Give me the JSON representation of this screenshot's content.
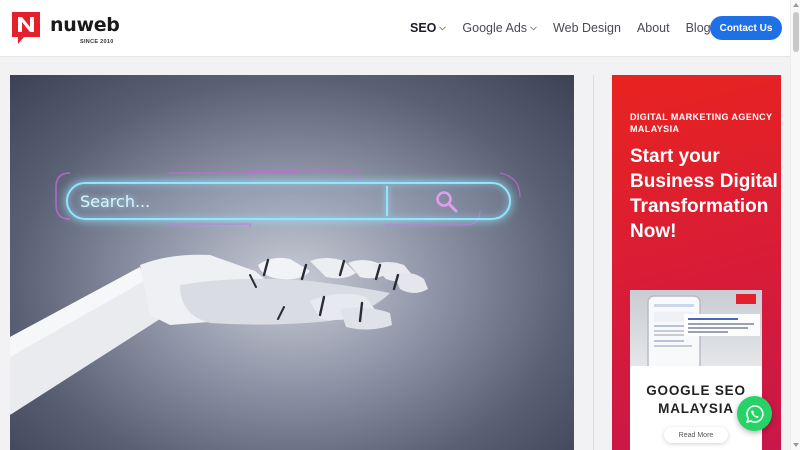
{
  "brand": {
    "name": "nuweb",
    "since": "SINCE 2010",
    "logo_color": "#e3212d",
    "logo_letter": "N"
  },
  "nav": {
    "items": [
      {
        "label": "SEO",
        "dropdown": true,
        "active": true
      },
      {
        "label": "Google Ads",
        "dropdown": true,
        "active": false
      },
      {
        "label": "Web Design",
        "dropdown": false,
        "active": false
      },
      {
        "label": "About",
        "dropdown": false,
        "active": false
      },
      {
        "label": "Blog",
        "dropdown": true,
        "active": false
      }
    ],
    "cta_label": "Contact Us",
    "cta_color": "#1f6fe5"
  },
  "hero": {
    "search_text": "Search...",
    "glow_color": "#8fe6ff",
    "icons": [
      "magnifier-icon",
      "robot-hand-illustration"
    ]
  },
  "sidebar_ad": {
    "kicker": "DIGITAL MARKETING AGENCY MALAYSIA",
    "headline": "Start your Business Digital Transformation Now!",
    "card_title": "GOOGLE SEO MALAYSIA",
    "read_more": "Read More",
    "accent": "#e3212d"
  },
  "floating": {
    "whatsapp_color": "#25d366",
    "icon": "whatsapp-icon"
  }
}
